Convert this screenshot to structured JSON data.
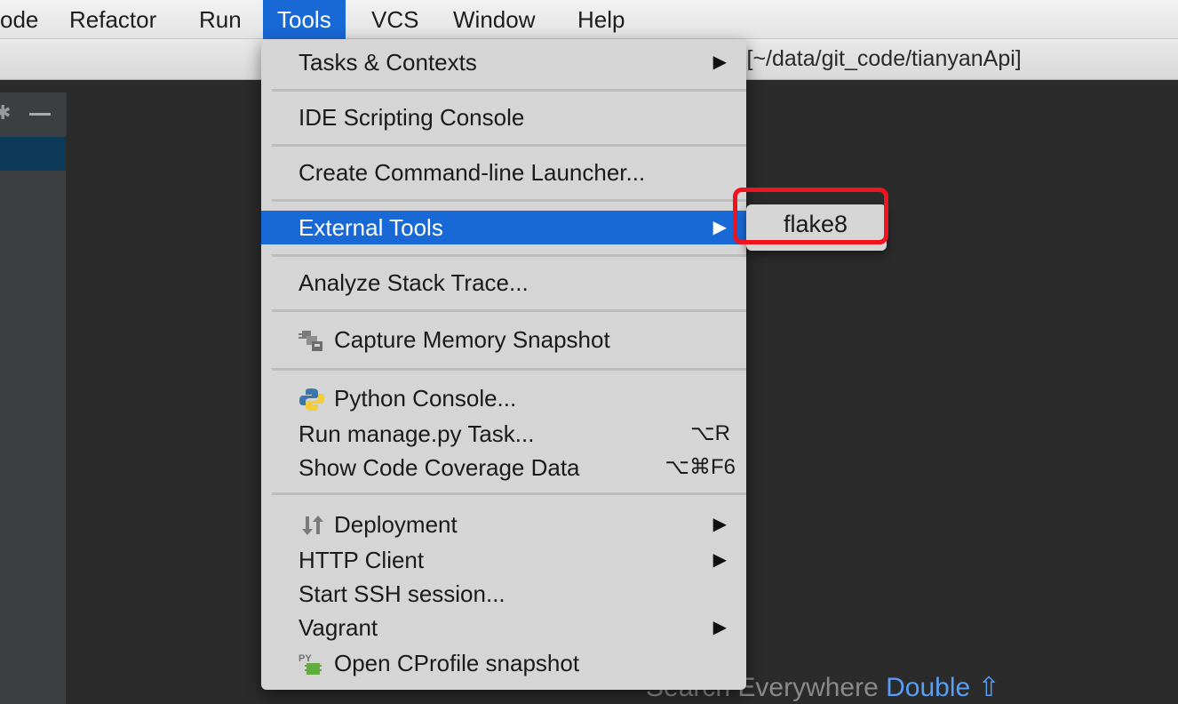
{
  "menubar": {
    "items": [
      "ode",
      "Refactor",
      "Run",
      "Tools",
      "VCS",
      "Window",
      "Help"
    ],
    "active": "Tools"
  },
  "window": {
    "title_fragment": "i [~/data/git_code/tianyanApi]"
  },
  "tools_menu": {
    "items": [
      {
        "label": "Tasks & Contexts",
        "submenu": true
      },
      {
        "label": "IDE Scripting Console"
      },
      {
        "label": "Create Command-line Launcher..."
      },
      {
        "label": "External Tools",
        "submenu": true,
        "selected": true
      },
      {
        "label": "Analyze Stack Trace..."
      },
      {
        "label": "Capture Memory Snapshot",
        "icon": "memory-snapshot-icon"
      },
      {
        "label": "Python Console...",
        "icon": "python-icon"
      },
      {
        "label": "Run manage.py Task...",
        "shortcut": "⌥R"
      },
      {
        "label": "Show Code Coverage Data",
        "shortcut": "⌥⌘F6"
      },
      {
        "label": "Deployment",
        "icon": "deployment-icon",
        "submenu": true
      },
      {
        "label": "HTTP Client",
        "submenu": true
      },
      {
        "label": "Start SSH session..."
      },
      {
        "label": "Vagrant",
        "submenu": true
      },
      {
        "label": "Open CProfile snapshot",
        "icon": "cprofile-icon"
      }
    ],
    "arrow_glyph": "▶"
  },
  "external_tools_submenu": {
    "items": [
      {
        "label": "flake8"
      }
    ]
  },
  "editor": {
    "hint_text": "Search Everywhere",
    "hint_key": "Double ⇧"
  },
  "colors": {
    "selection": "#1868d6",
    "highlight": "#f0141e",
    "editor_bg": "#2b2b2b"
  }
}
